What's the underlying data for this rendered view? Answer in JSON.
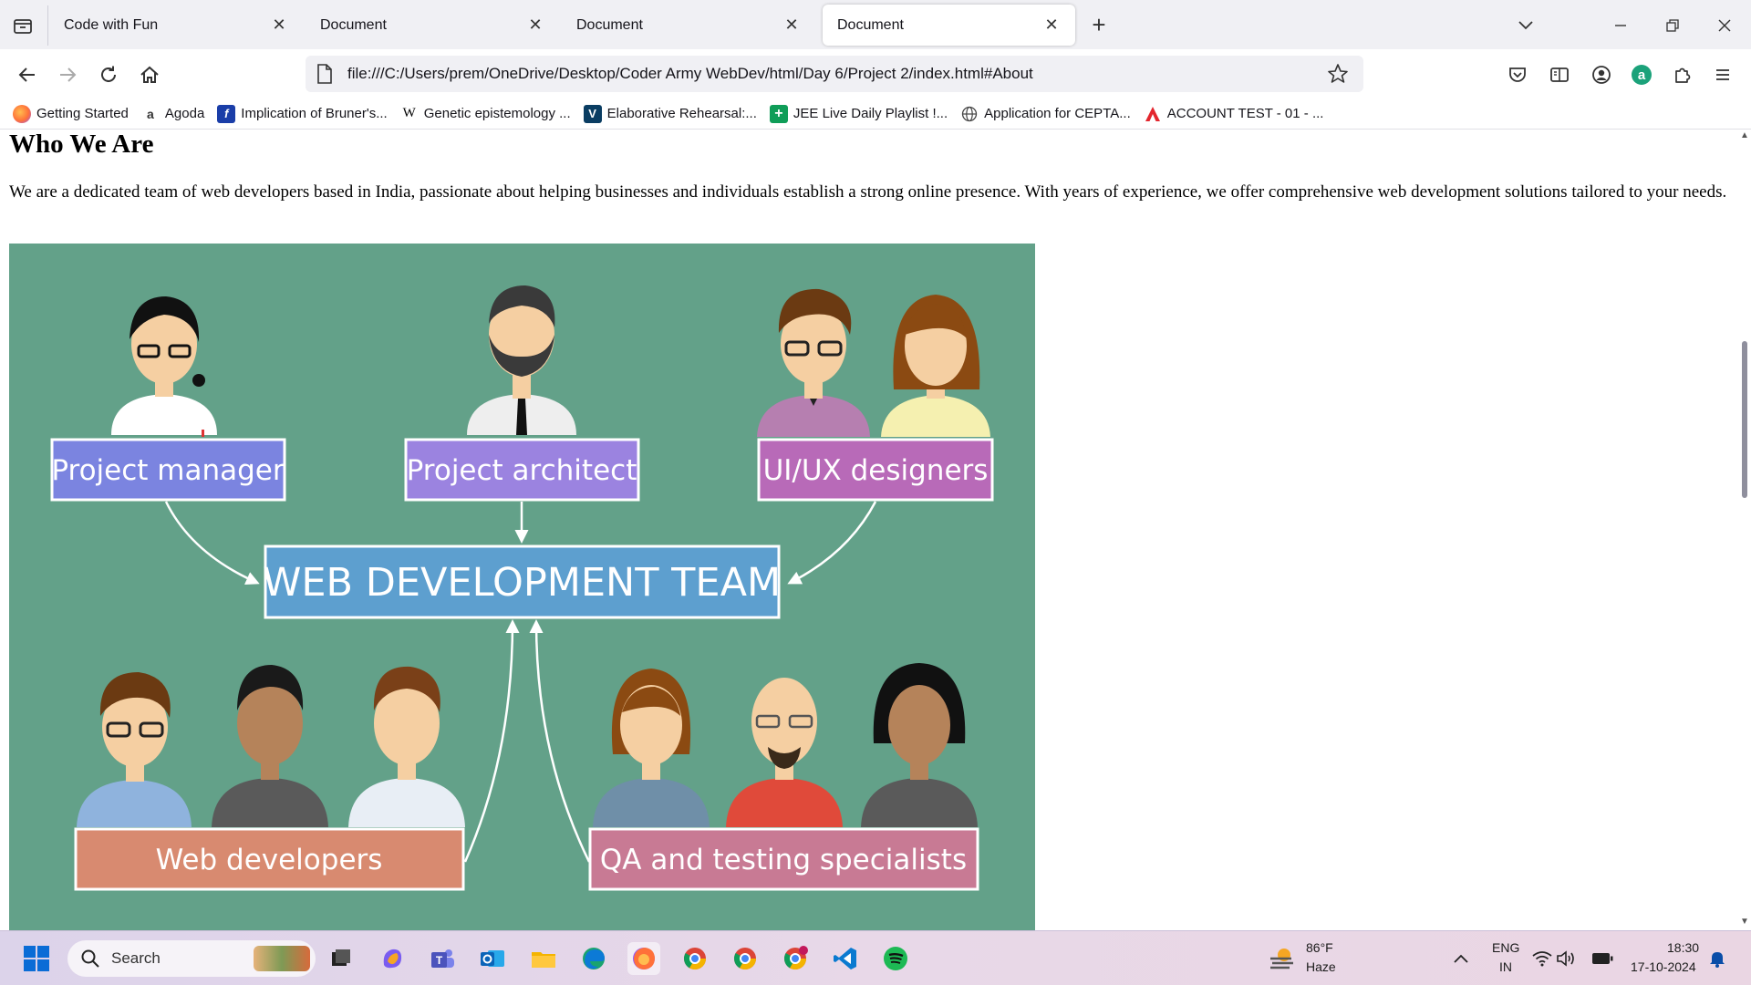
{
  "browser": {
    "tabs": [
      {
        "title": "Code with Fun",
        "active": false
      },
      {
        "title": "Document",
        "active": false
      },
      {
        "title": "Document",
        "active": false
      },
      {
        "title": "Document",
        "active": true
      }
    ],
    "url": "file:///C:/Users/prem/OneDrive/Desktop/Coder Army WebDev/html/Day 6/Project 2/index.html#About",
    "bookmarks": [
      {
        "label": "Getting Started",
        "icon": "firefox-icon",
        "color": "#ff7139"
      },
      {
        "label": "Agoda",
        "icon": "agoda-icon",
        "color": "#5392f9"
      },
      {
        "label": "Implication of Bruner's...",
        "icon": "document-icon",
        "color": "#1a3ea8"
      },
      {
        "label": "Genetic epistemology ...",
        "icon": "wikipedia-icon",
        "color": "#000000"
      },
      {
        "label": "Elaborative Rehearsal:...",
        "icon": "v-logo-icon",
        "color": "#0a3d62"
      },
      {
        "label": "JEE Live Daily Playlist !...",
        "icon": "plus-icon",
        "color": "#0f9d58"
      },
      {
        "label": "Application for CEPTA...",
        "icon": "globe-icon",
        "color": "#444444"
      },
      {
        "label": "ACCOUNT TEST - 01 - ...",
        "icon": "a-logo-icon",
        "color": "#e3262e"
      }
    ]
  },
  "page": {
    "heading": "Who We Are",
    "paragraph": "We are a dedicated team of web developers based in India, passionate about helping businesses and individuals establish a strong online presence. With years of experience, we offer comprehensive web development solutions tailored to your needs.",
    "image": {
      "background": "#63a189",
      "labels": {
        "project_manager": "Project manager",
        "project_architect": "Project architect",
        "uiux": "UI/UX designers",
        "center": "WEB DEVELOPMENT TEAM",
        "web_developers": "Web developers",
        "qa": "QA and testing specialists"
      }
    }
  },
  "taskbar": {
    "search_placeholder": "Search",
    "weather_temp": "86°F",
    "weather_desc": "Haze",
    "lang_line1": "ENG",
    "lang_line2": "IN",
    "time": "18:30",
    "date": "17-10-2024"
  }
}
